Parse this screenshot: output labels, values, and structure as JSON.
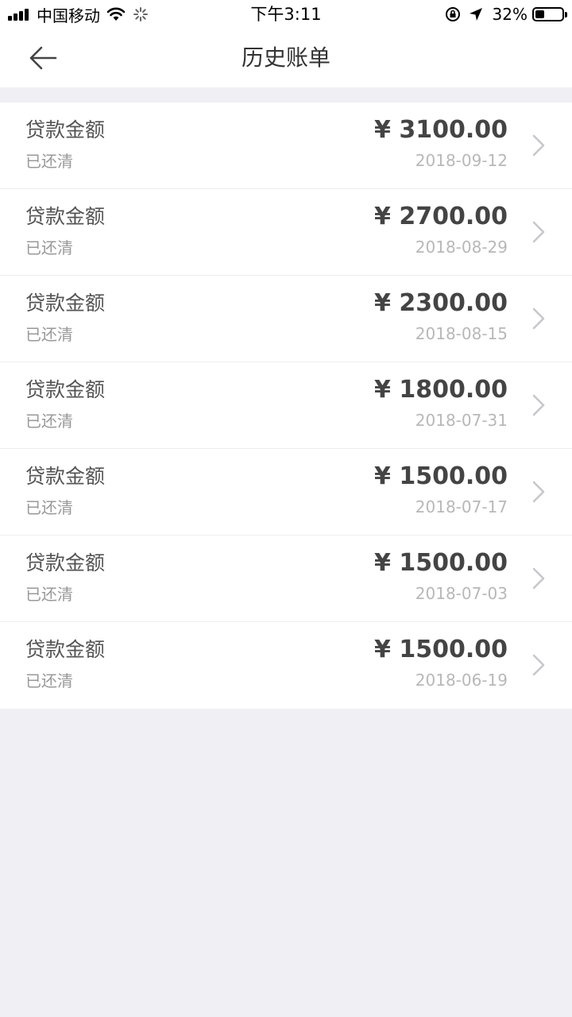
{
  "status_bar": {
    "carrier": "中国移动",
    "time": "下午3:11",
    "battery": "32%"
  },
  "nav": {
    "title": "历史账单"
  },
  "bills": [
    {
      "label": "贷款金额",
      "status": "已还清",
      "amount": "¥ 3100.00",
      "date": "2018-09-12"
    },
    {
      "label": "贷款金额",
      "status": "已还清",
      "amount": "¥ 2700.00",
      "date": "2018-08-29"
    },
    {
      "label": "贷款金额",
      "status": "已还清",
      "amount": "¥ 2300.00",
      "date": "2018-08-15"
    },
    {
      "label": "贷款金额",
      "status": "已还清",
      "amount": "¥ 1800.00",
      "date": "2018-07-31"
    },
    {
      "label": "贷款金额",
      "status": "已还清",
      "amount": "¥ 1500.00",
      "date": "2018-07-17"
    },
    {
      "label": "贷款金额",
      "status": "已还清",
      "amount": "¥ 1500.00",
      "date": "2018-07-03"
    },
    {
      "label": "贷款金额",
      "status": "已还清",
      "amount": "¥ 1500.00",
      "date": "2018-06-19"
    }
  ],
  "icons": {
    "back": "arrow-left-icon",
    "chevron": "chevron-right-icon",
    "signal": "signal-icon",
    "wifi": "wifi-icon",
    "loading": "loading-spinner-icon",
    "rotation_lock": "rotation-lock-icon",
    "location": "location-arrow-icon",
    "battery": "battery-icon"
  },
  "colors": {
    "background": "#efeff4",
    "surface": "#ffffff",
    "amount_text": "#444444",
    "muted_text": "#999999"
  }
}
